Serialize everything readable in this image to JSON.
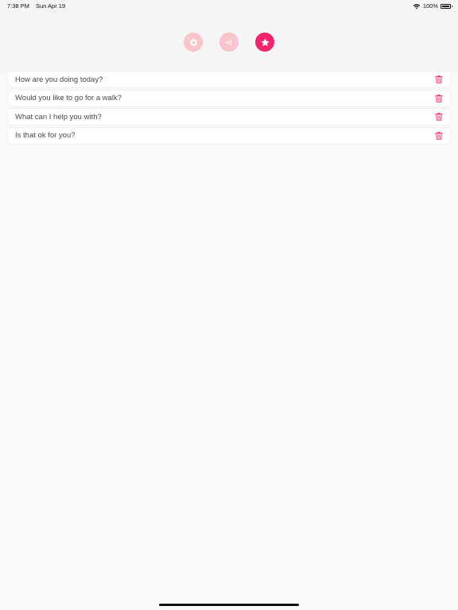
{
  "status_bar": {
    "time": "7:38 PM",
    "date": "Sun Apr 19",
    "battery": "100%",
    "wifi_icon": "wifi-icon",
    "battery_icon": "battery-icon"
  },
  "toolbar": {
    "buttons": [
      {
        "icon": "gear-icon",
        "active": false
      },
      {
        "icon": "speak-icon",
        "active": false
      },
      {
        "icon": "star-icon",
        "active": true
      }
    ],
    "accent_color": "#f0246a",
    "inactive_color": "#f9c4cc"
  },
  "favorites": {
    "items": [
      {
        "label": "How are you doing today?"
      },
      {
        "label": "Would you like to go for a walk?"
      },
      {
        "label": "What can I help you with?"
      },
      {
        "label": "Is that ok for you?"
      }
    ],
    "delete_icon": "trash-icon"
  }
}
